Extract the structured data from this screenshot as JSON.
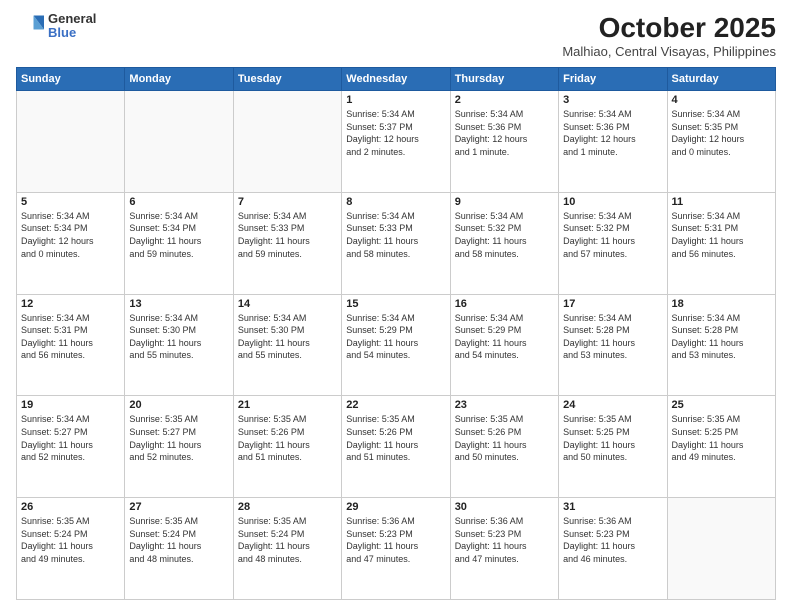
{
  "header": {
    "logo": {
      "general": "General",
      "blue": "Blue"
    },
    "title": "October 2025",
    "location": "Malhiao, Central Visayas, Philippines"
  },
  "days_of_week": [
    "Sunday",
    "Monday",
    "Tuesday",
    "Wednesday",
    "Thursday",
    "Friday",
    "Saturday"
  ],
  "weeks": [
    [
      {
        "day": "",
        "info": ""
      },
      {
        "day": "",
        "info": ""
      },
      {
        "day": "",
        "info": ""
      },
      {
        "day": "1",
        "info": "Sunrise: 5:34 AM\nSunset: 5:37 PM\nDaylight: 12 hours\nand 2 minutes."
      },
      {
        "day": "2",
        "info": "Sunrise: 5:34 AM\nSunset: 5:36 PM\nDaylight: 12 hours\nand 1 minute."
      },
      {
        "day": "3",
        "info": "Sunrise: 5:34 AM\nSunset: 5:36 PM\nDaylight: 12 hours\nand 1 minute."
      },
      {
        "day": "4",
        "info": "Sunrise: 5:34 AM\nSunset: 5:35 PM\nDaylight: 12 hours\nand 0 minutes."
      }
    ],
    [
      {
        "day": "5",
        "info": "Sunrise: 5:34 AM\nSunset: 5:34 PM\nDaylight: 12 hours\nand 0 minutes."
      },
      {
        "day": "6",
        "info": "Sunrise: 5:34 AM\nSunset: 5:34 PM\nDaylight: 11 hours\nand 59 minutes."
      },
      {
        "day": "7",
        "info": "Sunrise: 5:34 AM\nSunset: 5:33 PM\nDaylight: 11 hours\nand 59 minutes."
      },
      {
        "day": "8",
        "info": "Sunrise: 5:34 AM\nSunset: 5:33 PM\nDaylight: 11 hours\nand 58 minutes."
      },
      {
        "day": "9",
        "info": "Sunrise: 5:34 AM\nSunset: 5:32 PM\nDaylight: 11 hours\nand 58 minutes."
      },
      {
        "day": "10",
        "info": "Sunrise: 5:34 AM\nSunset: 5:32 PM\nDaylight: 11 hours\nand 57 minutes."
      },
      {
        "day": "11",
        "info": "Sunrise: 5:34 AM\nSunset: 5:31 PM\nDaylight: 11 hours\nand 56 minutes."
      }
    ],
    [
      {
        "day": "12",
        "info": "Sunrise: 5:34 AM\nSunset: 5:31 PM\nDaylight: 11 hours\nand 56 minutes."
      },
      {
        "day": "13",
        "info": "Sunrise: 5:34 AM\nSunset: 5:30 PM\nDaylight: 11 hours\nand 55 minutes."
      },
      {
        "day": "14",
        "info": "Sunrise: 5:34 AM\nSunset: 5:30 PM\nDaylight: 11 hours\nand 55 minutes."
      },
      {
        "day": "15",
        "info": "Sunrise: 5:34 AM\nSunset: 5:29 PM\nDaylight: 11 hours\nand 54 minutes."
      },
      {
        "day": "16",
        "info": "Sunrise: 5:34 AM\nSunset: 5:29 PM\nDaylight: 11 hours\nand 54 minutes."
      },
      {
        "day": "17",
        "info": "Sunrise: 5:34 AM\nSunset: 5:28 PM\nDaylight: 11 hours\nand 53 minutes."
      },
      {
        "day": "18",
        "info": "Sunrise: 5:34 AM\nSunset: 5:28 PM\nDaylight: 11 hours\nand 53 minutes."
      }
    ],
    [
      {
        "day": "19",
        "info": "Sunrise: 5:34 AM\nSunset: 5:27 PM\nDaylight: 11 hours\nand 52 minutes."
      },
      {
        "day": "20",
        "info": "Sunrise: 5:35 AM\nSunset: 5:27 PM\nDaylight: 11 hours\nand 52 minutes."
      },
      {
        "day": "21",
        "info": "Sunrise: 5:35 AM\nSunset: 5:26 PM\nDaylight: 11 hours\nand 51 minutes."
      },
      {
        "day": "22",
        "info": "Sunrise: 5:35 AM\nSunset: 5:26 PM\nDaylight: 11 hours\nand 51 minutes."
      },
      {
        "day": "23",
        "info": "Sunrise: 5:35 AM\nSunset: 5:26 PM\nDaylight: 11 hours\nand 50 minutes."
      },
      {
        "day": "24",
        "info": "Sunrise: 5:35 AM\nSunset: 5:25 PM\nDaylight: 11 hours\nand 50 minutes."
      },
      {
        "day": "25",
        "info": "Sunrise: 5:35 AM\nSunset: 5:25 PM\nDaylight: 11 hours\nand 49 minutes."
      }
    ],
    [
      {
        "day": "26",
        "info": "Sunrise: 5:35 AM\nSunset: 5:24 PM\nDaylight: 11 hours\nand 49 minutes."
      },
      {
        "day": "27",
        "info": "Sunrise: 5:35 AM\nSunset: 5:24 PM\nDaylight: 11 hours\nand 48 minutes."
      },
      {
        "day": "28",
        "info": "Sunrise: 5:35 AM\nSunset: 5:24 PM\nDaylight: 11 hours\nand 48 minutes."
      },
      {
        "day": "29",
        "info": "Sunrise: 5:36 AM\nSunset: 5:23 PM\nDaylight: 11 hours\nand 47 minutes."
      },
      {
        "day": "30",
        "info": "Sunrise: 5:36 AM\nSunset: 5:23 PM\nDaylight: 11 hours\nand 47 minutes."
      },
      {
        "day": "31",
        "info": "Sunrise: 5:36 AM\nSunset: 5:23 PM\nDaylight: 11 hours\nand 46 minutes."
      },
      {
        "day": "",
        "info": ""
      }
    ]
  ]
}
